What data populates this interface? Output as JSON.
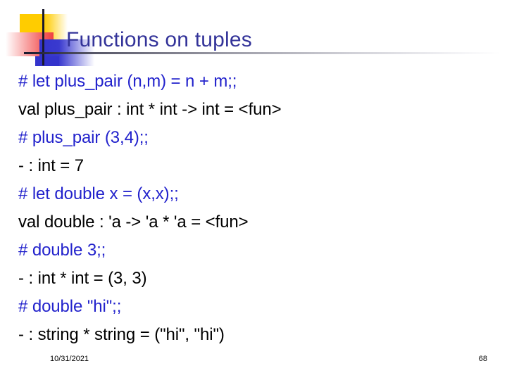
{
  "slide": {
    "title": "Functions on tuples",
    "title_color": "#333399",
    "background_color": "#ffffff"
  },
  "decoration": {
    "yellow_color": "#FFCC00",
    "red_color": "#F04040",
    "blue_color": "#3333CC",
    "rule_color": "#1a1a2e"
  },
  "transcript": {
    "prompt_color": "#2222CC",
    "output_color": "#000000",
    "lines": [
      {
        "kind": "prompt",
        "text": "# let plus_pair (n,m) = n + m;;"
      },
      {
        "kind": "output",
        "text": "val plus_pair : int * int -> int = <fun>"
      },
      {
        "kind": "prompt",
        "text": "# plus_pair (3,4);;"
      },
      {
        "kind": "output",
        "text": "- : int = 7"
      },
      {
        "kind": "prompt",
        "text": "# let double x = (x,x);;"
      },
      {
        "kind": "output",
        "text": "val double : 'a -> 'a * 'a = <fun>"
      },
      {
        "kind": "prompt",
        "text": "# double 3;;"
      },
      {
        "kind": "output",
        "text": "- : int * int = (3, 3)"
      },
      {
        "kind": "prompt",
        "text": "# double \"hi\";;"
      },
      {
        "kind": "output",
        "text": "- : string * string = (\"hi\", \"hi\")"
      }
    ]
  },
  "footer": {
    "date": "10/31/2021",
    "page_number": "68"
  }
}
